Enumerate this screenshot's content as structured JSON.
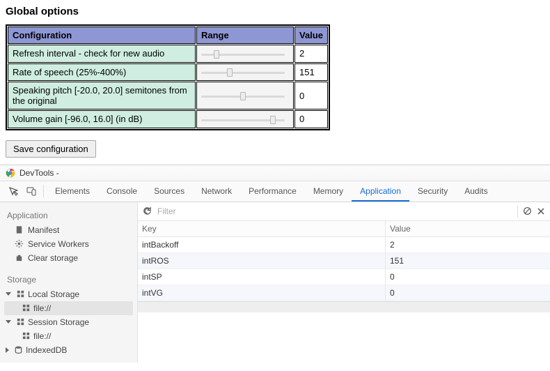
{
  "page": {
    "title": "Global options",
    "save_button": "Save configuration"
  },
  "table": {
    "headers": {
      "config": "Configuration",
      "range": "Range",
      "value": "Value"
    },
    "rows": [
      {
        "label": "Refresh interval - check for new audio",
        "slider_pct": 18,
        "value": "2"
      },
      {
        "label": "Rate of speech (25%-400%)",
        "slider_pct": 34,
        "value": "151"
      },
      {
        "label": "Speaking pitch [-20.0, 20.0] semitones from the original",
        "slider_pct": 50,
        "value": "0"
      },
      {
        "label": "Volume gain [-96.0, 16.0] (in dB)",
        "slider_pct": 86,
        "value": "0"
      }
    ]
  },
  "devtools": {
    "window_label": "DevTools -",
    "tabs": [
      "Elements",
      "Console",
      "Sources",
      "Network",
      "Performance",
      "Memory",
      "Application",
      "Security",
      "Audits"
    ],
    "active_tab": "Application",
    "filter_placeholder": "Filter",
    "sidebar": {
      "section_app": "Application",
      "app_items": [
        "Manifest",
        "Service Workers",
        "Clear storage"
      ],
      "section_storage": "Storage",
      "storage_tree": [
        {
          "label": "Local Storage",
          "child": "file://",
          "child_selected": true
        },
        {
          "label": "Session Storage",
          "child": "file://",
          "child_selected": false
        },
        {
          "label": "IndexedDB",
          "child": null
        }
      ]
    },
    "kv": {
      "headers": {
        "key": "Key",
        "value": "Value"
      },
      "rows": [
        {
          "key": "intBackoff",
          "value": "2"
        },
        {
          "key": "intROS",
          "value": "151"
        },
        {
          "key": "intSP",
          "value": "0"
        },
        {
          "key": "intVG",
          "value": "0"
        }
      ]
    }
  }
}
